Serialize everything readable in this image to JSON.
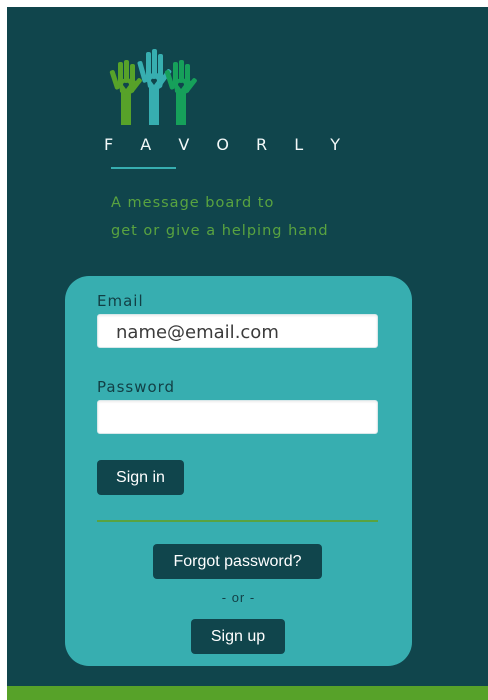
{
  "brand": {
    "name": "F A V O R L Y",
    "tagline_line1": "A message board to",
    "tagline_line2": "get or give a helping hand",
    "logo_icon": "three-raised-hands-logo"
  },
  "login": {
    "email_label": "Email",
    "email_placeholder": "name@email.com",
    "email_value": "",
    "password_label": "Password",
    "password_value": "",
    "signin_label": "Sign in",
    "forgot_label": "Forgot password?",
    "or_text": "- or -",
    "signup_label": "Sign up"
  },
  "colors": {
    "background": "#10454c",
    "card": "#37aeb0",
    "accent_green": "#59a340",
    "footer_green": "#57a229",
    "button": "#10454c"
  }
}
